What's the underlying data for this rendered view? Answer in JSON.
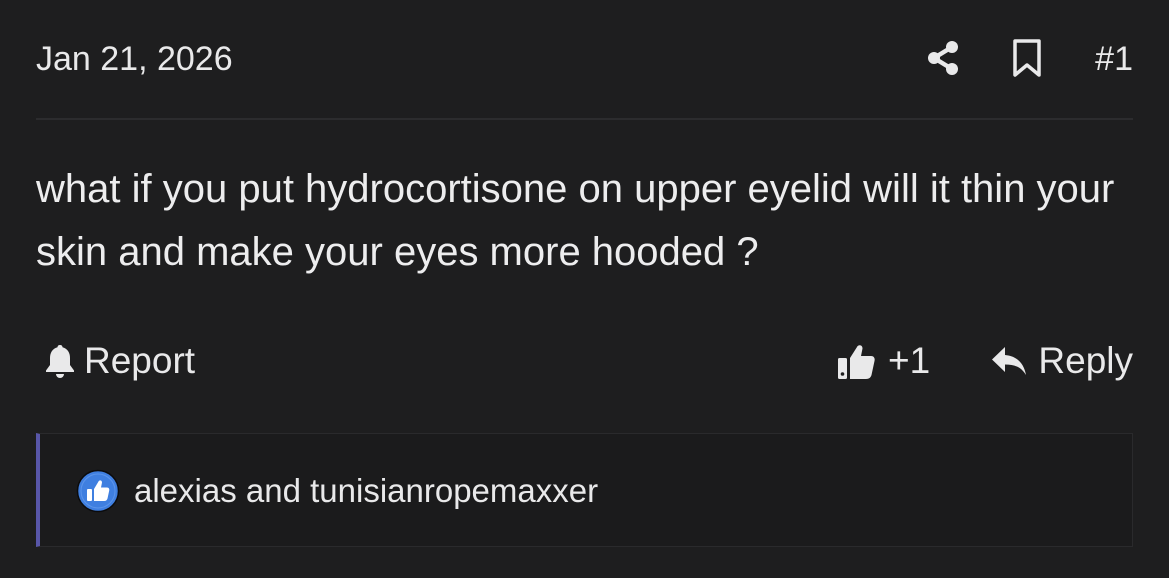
{
  "post": {
    "date": "Jan 21, 2026",
    "number": "#1",
    "body": "what if you put hydrocortisone on upper eyelid will it thin your skin and make your eyes more hooded ?",
    "actions": {
      "share_icon": "share-icon",
      "bookmark_icon": "bookmark-icon"
    },
    "footer": {
      "report_label": "Report",
      "report_icon": "bell-icon",
      "like_count": "+1",
      "like_icon": "thumbs-up-icon",
      "reply_label": "Reply",
      "reply_icon": "reply-arrow-icon"
    },
    "reactions": {
      "icon": "like-badge-icon",
      "text": "alexias and tunisianropemaxxer"
    }
  },
  "colors": {
    "background": "#1e1e1f",
    "text": "#e9e9ea",
    "accent_bar": "#5856a8",
    "like_badge": "#3f7fe0"
  }
}
